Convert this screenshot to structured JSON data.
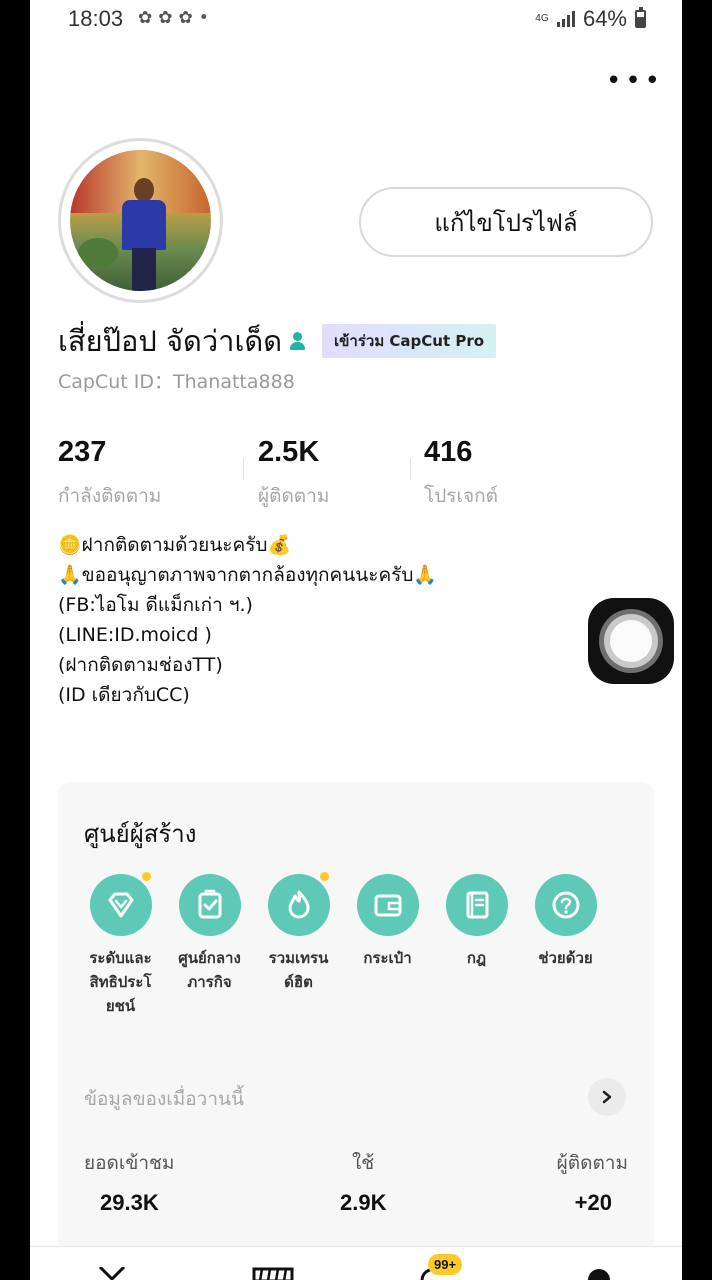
{
  "status_bar": {
    "time": "18:03",
    "network": "4G",
    "battery": "64%",
    "battery_level": 0.64
  },
  "profile": {
    "edit_button": "แก้ไขโปรไฟล์",
    "name": "เสี่ยป๊อป จัดว่าเด็ด",
    "pro_badge": "เข้าร่วม CapCut Pro",
    "capcut_id": "CapCut ID：Thanatta888"
  },
  "stats": [
    {
      "value": "237",
      "label": "กำลังติดตาม"
    },
    {
      "value": "2.5K",
      "label": "ผู้ติดตาม"
    },
    {
      "value": "416",
      "label": "โปรเจกต์"
    }
  ],
  "bio": [
    "🪙ฝากติดตามด้วยนะครับ💰",
    "🙏ขออนุญาตภาพจากตากล้องทุกคนนะครับ🙏",
    "(FB:ไอโม ดีแม็กเก่า ฯ.)",
    "(LINE:ID.moicd )",
    "(ฝากติดตามช่องTT)",
    "(ID เดียวกับCC)"
  ],
  "creator_center": {
    "title": "ศูนย์ผู้สร้าง",
    "items": [
      {
        "label": "ระดับและสิทธิประโยชน์",
        "icon": "diamond-icon"
      },
      {
        "label": "ศูนย์กลางภารกิจ",
        "icon": "task-board-icon"
      },
      {
        "label": "รวมเทรนด์ฮิต",
        "icon": "flame-icon"
      },
      {
        "label": "กระเป๋า",
        "icon": "wallet-icon"
      },
      {
        "label": "กฎ",
        "icon": "rulebook-icon"
      },
      {
        "label": "ช่วยด้วย",
        "icon": "help-icon"
      }
    ],
    "yesterday_label": "ข้อมูลของเมื่อวานนี้",
    "metrics": [
      {
        "label": "ยอดเข้าชม",
        "value": "29.3K"
      },
      {
        "label": "ใช้",
        "value": "2.9K"
      },
      {
        "label": "ผู้ติดตาม",
        "value": "+20"
      }
    ]
  },
  "bottom_nav": {
    "badge": "99+"
  },
  "colors": {
    "accent": "#5fc9b7",
    "verified": "#21b3a4",
    "badge": "#ffc928"
  }
}
